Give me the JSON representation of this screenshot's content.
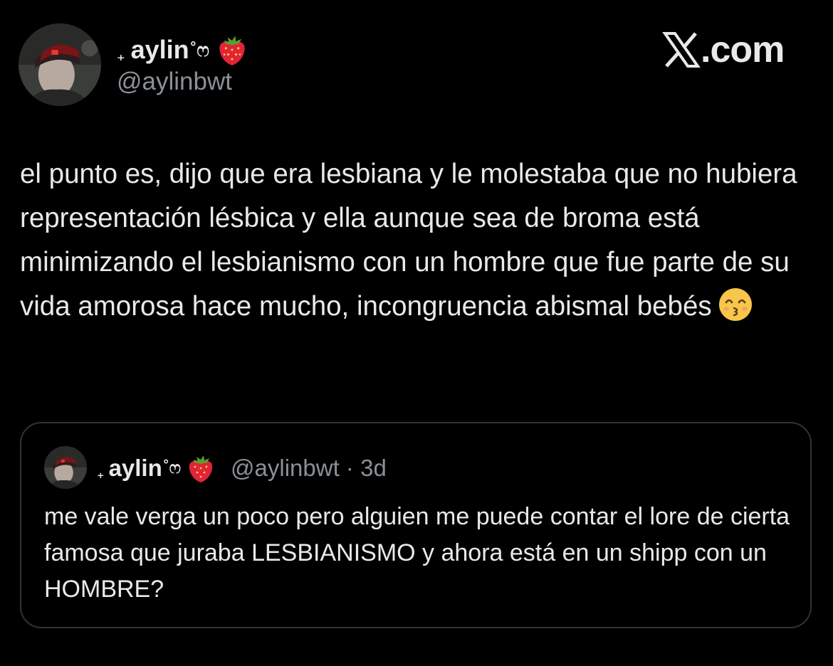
{
  "author": {
    "plus": "₊",
    "name": "aylin",
    "suffix": "˚ෆ",
    "emoji_name": "strawberry-icon",
    "handle": "@aylinbwt"
  },
  "brand": {
    "logo_name": "x-logo-icon",
    "suffix": ".com"
  },
  "tweet": {
    "text": "el punto es, dijo que era lesbiana y le molestaba que no hubiera representación lésbica y ella aunque sea de broma está minimizando el lesbianismo con un hombre que fue parte de su vida amorosa hace mucho, incongruencia abismal bebés",
    "emoji_name": "kissing-smiling-eyes-icon"
  },
  "quote": {
    "plus": "₊",
    "name": "aylin",
    "suffix": "˚ෆ",
    "handle": "@aylinbwt",
    "separator": "·",
    "time": "3d",
    "text": "me vale verga un poco pero alguien me puede contar el lore de cierta famosa que juraba LESBIANISMO y ahora está en un shipp con un HOMBRE?"
  },
  "colors": {
    "background": "#000000",
    "text": "#e7e9ea",
    "muted": "#8b9096",
    "border": "#2f3336"
  }
}
